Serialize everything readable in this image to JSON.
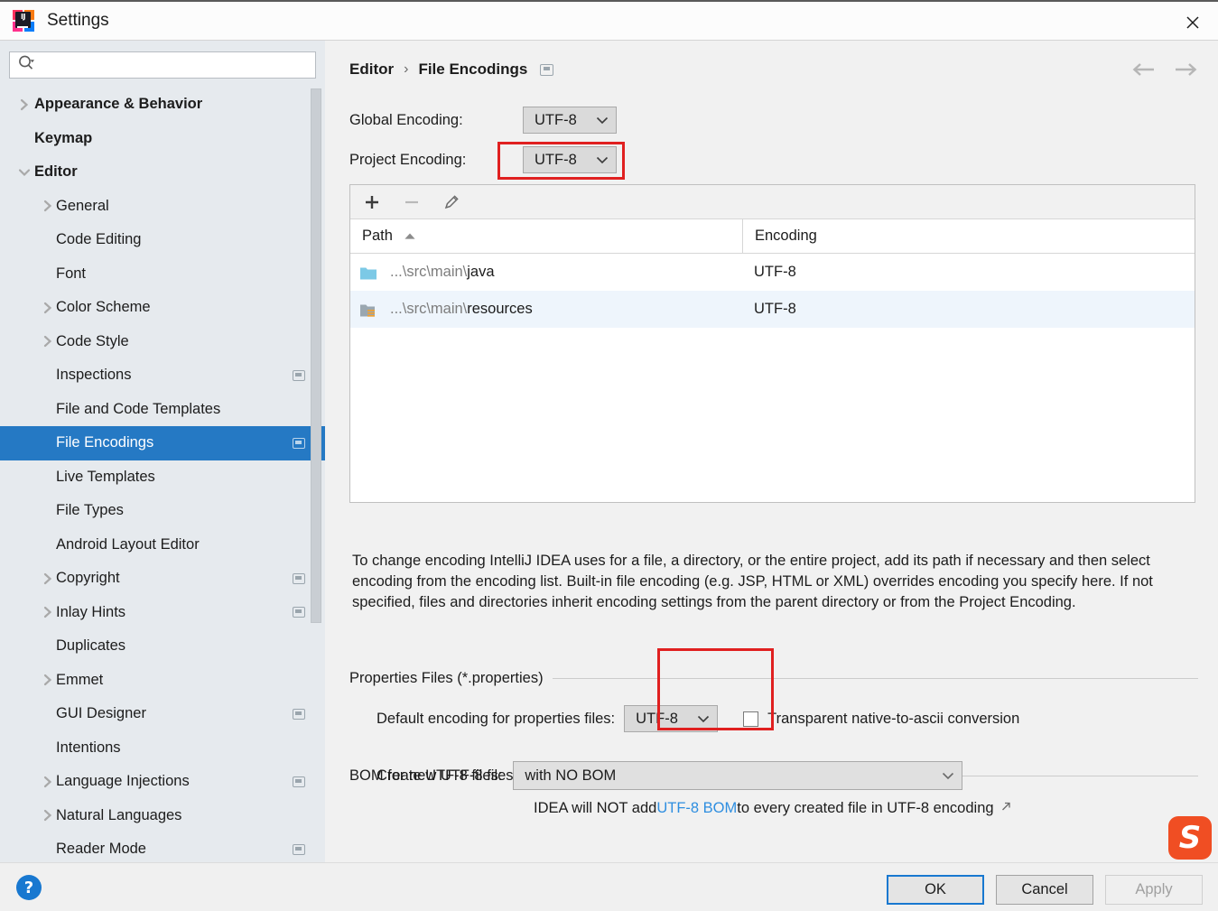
{
  "window": {
    "title": "Settings",
    "logo_icon": "intellij-idea-logo",
    "close_icon": "close-icon"
  },
  "sidebar": {
    "search": {
      "placeholder": "",
      "value": "",
      "icon": "search-icon"
    },
    "items": [
      {
        "label": "Appearance & Behavior",
        "twisty": "chevron-right",
        "depth": 0,
        "bold": true,
        "badge": false,
        "selected": false
      },
      {
        "label": "Keymap",
        "twisty": "none",
        "depth": 0,
        "bold": true,
        "badge": false,
        "selected": false
      },
      {
        "label": "Editor",
        "twisty": "chevron-down",
        "depth": 0,
        "bold": true,
        "badge": false,
        "selected": false
      },
      {
        "label": "General",
        "twisty": "chevron-right",
        "depth": 1,
        "bold": false,
        "badge": false,
        "selected": false
      },
      {
        "label": "Code Editing",
        "twisty": "none",
        "depth": 1,
        "bold": false,
        "badge": false,
        "selected": false
      },
      {
        "label": "Font",
        "twisty": "none",
        "depth": 1,
        "bold": false,
        "badge": false,
        "selected": false
      },
      {
        "label": "Color Scheme",
        "twisty": "chevron-right",
        "depth": 1,
        "bold": false,
        "badge": false,
        "selected": false
      },
      {
        "label": "Code Style",
        "twisty": "chevron-right",
        "depth": 1,
        "bold": false,
        "badge": false,
        "selected": false
      },
      {
        "label": "Inspections",
        "twisty": "none",
        "depth": 1,
        "bold": false,
        "badge": true,
        "selected": false
      },
      {
        "label": "File and Code Templates",
        "twisty": "none",
        "depth": 1,
        "bold": false,
        "badge": false,
        "selected": false
      },
      {
        "label": "File Encodings",
        "twisty": "none",
        "depth": 1,
        "bold": false,
        "badge": true,
        "selected": true
      },
      {
        "label": "Live Templates",
        "twisty": "none",
        "depth": 1,
        "bold": false,
        "badge": false,
        "selected": false
      },
      {
        "label": "File Types",
        "twisty": "none",
        "depth": 1,
        "bold": false,
        "badge": false,
        "selected": false
      },
      {
        "label": "Android Layout Editor",
        "twisty": "none",
        "depth": 1,
        "bold": false,
        "badge": false,
        "selected": false
      },
      {
        "label": "Copyright",
        "twisty": "chevron-right",
        "depth": 1,
        "bold": false,
        "badge": true,
        "selected": false
      },
      {
        "label": "Inlay Hints",
        "twisty": "chevron-right",
        "depth": 1,
        "bold": false,
        "badge": true,
        "selected": false
      },
      {
        "label": "Duplicates",
        "twisty": "none",
        "depth": 1,
        "bold": false,
        "badge": false,
        "selected": false
      },
      {
        "label": "Emmet",
        "twisty": "chevron-right",
        "depth": 1,
        "bold": false,
        "badge": false,
        "selected": false
      },
      {
        "label": "GUI Designer",
        "twisty": "none",
        "depth": 1,
        "bold": false,
        "badge": true,
        "selected": false
      },
      {
        "label": "Intentions",
        "twisty": "none",
        "depth": 1,
        "bold": false,
        "badge": false,
        "selected": false
      },
      {
        "label": "Language Injections",
        "twisty": "chevron-right",
        "depth": 1,
        "bold": false,
        "badge": true,
        "selected": false
      },
      {
        "label": "Natural Languages",
        "twisty": "chevron-right",
        "depth": 1,
        "bold": false,
        "badge": false,
        "selected": false
      },
      {
        "label": "Reader Mode",
        "twisty": "none",
        "depth": 1,
        "bold": false,
        "badge": true,
        "selected": false
      }
    ]
  },
  "content": {
    "breadcrumb": {
      "root": "Editor",
      "separator": "›",
      "leaf": "File Encodings",
      "badge_icon": "project-scope-badge-icon"
    },
    "nav": {
      "back_icon": "arrow-left-icon",
      "forward_icon": "arrow-right-icon"
    },
    "global_encoding": {
      "label": "Global Encoding:",
      "value": "UTF-8"
    },
    "project_encoding": {
      "label": "Project Encoding:",
      "value": "UTF-8",
      "highlighted": true
    },
    "table": {
      "toolbar": {
        "add_icon": "plus-icon",
        "remove_icon": "minus-icon",
        "edit_icon": "pencil-icon"
      },
      "columns": [
        {
          "label": "Path",
          "sort": "ascending"
        },
        {
          "label": "Encoding",
          "sort": "none"
        }
      ],
      "rows": [
        {
          "icon": "folder-icon",
          "path_prefix": "...\\src\\main\\",
          "path_name": "java",
          "encoding": "UTF-8",
          "selected": false
        },
        {
          "icon": "resources-folder-icon",
          "path_prefix": "...\\src\\main\\",
          "path_name": "resources",
          "encoding": "UTF-8",
          "selected": true
        }
      ]
    },
    "description": "To change encoding IntelliJ IDEA uses for a file, a directory, or the entire project, add its path if necessary and then select encoding from the encoding list. Built-in file encoding (e.g. JSP, HTML or XML) overrides encoding you specify here. If not specified, files and directories inherit encoding settings from the parent directory or from the Project Encoding.",
    "properties_group": {
      "title": "Properties Files (*.properties)",
      "default_encoding_label": "Default encoding for properties files:",
      "default_encoding_value": "UTF-8",
      "highlighted": true,
      "checkbox_label": "Transparent native-to-ascii conversion",
      "checkbox_checked": false
    },
    "bom_group": {
      "title": "BOM for new UTF-8 files",
      "create_label": "Create UTF-8 files:",
      "create_value": "with NO BOM",
      "hint_prefix": "IDEA will NOT add ",
      "hint_link": "UTF-8 BOM",
      "hint_suffix": " to every created file in UTF-8 encoding",
      "hint_external_icon": "external-link-icon"
    }
  },
  "footer": {
    "help_icon": "help-icon",
    "ok_label": "OK",
    "cancel_label": "Cancel",
    "apply_label": "Apply",
    "apply_disabled": true
  },
  "watermark": {
    "letter": "S",
    "name": "screenshot-tool-watermark"
  },
  "colors": {
    "accent_blue": "#2579c4",
    "selection_row": "#eef5fc",
    "annotation_red": "#e02020",
    "link_blue": "#2e8ee0",
    "sidebar_bg": "#e6eaee",
    "content_bg": "#f1f1f1"
  }
}
